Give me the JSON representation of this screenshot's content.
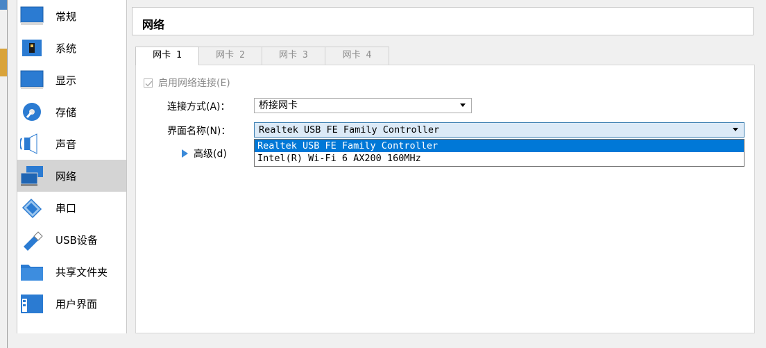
{
  "sidebar": {
    "items": [
      {
        "label": "常规",
        "icon": "general-icon"
      },
      {
        "label": "系统",
        "icon": "system-icon"
      },
      {
        "label": "显示",
        "icon": "display-icon"
      },
      {
        "label": "存储",
        "icon": "storage-icon"
      },
      {
        "label": "声音",
        "icon": "audio-icon"
      },
      {
        "label": "网络",
        "icon": "network-icon",
        "selected": true
      },
      {
        "label": "串口",
        "icon": "serial-port-icon"
      },
      {
        "label": "USB设备",
        "icon": "usb-icon"
      },
      {
        "label": "共享文件夹",
        "icon": "shared-folder-icon"
      },
      {
        "label": "用户界面",
        "icon": "user-interface-icon"
      }
    ]
  },
  "page": {
    "title": "网络"
  },
  "tabs": [
    {
      "label": "网卡 1",
      "active": true
    },
    {
      "label": "网卡 2"
    },
    {
      "label": "网卡 3"
    },
    {
      "label": "网卡 4"
    }
  ],
  "adapter": {
    "enable_label": "启用网络连接(E)",
    "enable_checked": true,
    "attached_to_label": "连接方式(A)：",
    "attached_to_value": "桥接网卡",
    "name_label": "界面名称(N)：",
    "name_value": "Realtek USB FE Family Controller",
    "advanced_label": "高级(d)",
    "name_options": [
      "Realtek USB FE Family Controller",
      "Intel(R) Wi-Fi 6 AX200 160MHz"
    ],
    "highlighted_option": 0
  },
  "colors": {
    "selection": "#0078d7",
    "sidebar_selected": "#d4d4d4",
    "focus_border": "#3c7fb1",
    "focus_fill": "#dceaf7",
    "expander": "#3b8ad9"
  }
}
